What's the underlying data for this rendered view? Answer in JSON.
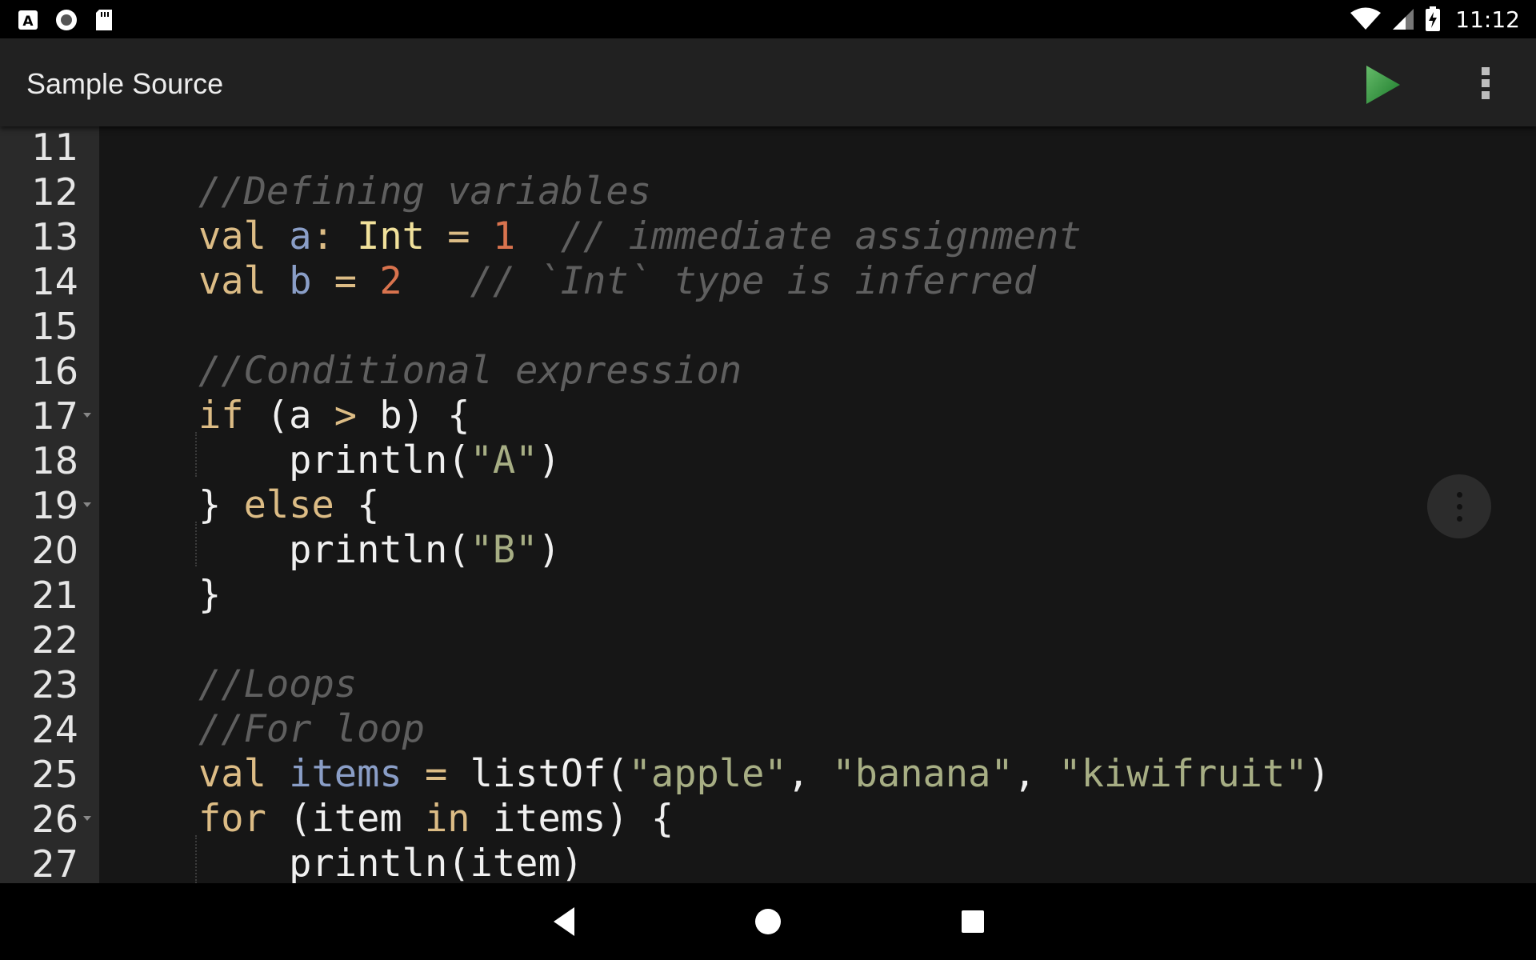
{
  "status_bar": {
    "time": "11:12",
    "left_icons": [
      "a-box-icon",
      "circle-icon",
      "sd-card-icon"
    ],
    "right_icons": [
      "wifi-icon",
      "signal-icon",
      "battery-charging-icon"
    ]
  },
  "app_bar": {
    "title": "Sample Source",
    "run_icon_color": "#43a047"
  },
  "editor": {
    "lines": [
      {
        "number": "11",
        "fold": false,
        "tokens": []
      },
      {
        "number": "12",
        "fold": false,
        "tokens": [
          {
            "t": "//Defining variables",
            "c": "comment"
          }
        ]
      },
      {
        "number": "13",
        "fold": false,
        "tokens": [
          {
            "t": "val",
            "c": "keyword"
          },
          {
            "t": " ",
            "c": "plain"
          },
          {
            "t": "a",
            "c": "var"
          },
          {
            "t": ": ",
            "c": "keyword"
          },
          {
            "t": "Int",
            "c": "type"
          },
          {
            "t": " = ",
            "c": "op"
          },
          {
            "t": "1",
            "c": "number"
          },
          {
            "t": "  ",
            "c": "plain"
          },
          {
            "t": "// immediate assignment",
            "c": "comment"
          }
        ]
      },
      {
        "number": "14",
        "fold": false,
        "tokens": [
          {
            "t": "val",
            "c": "keyword"
          },
          {
            "t": " ",
            "c": "plain"
          },
          {
            "t": "b",
            "c": "var"
          },
          {
            "t": " = ",
            "c": "op"
          },
          {
            "t": "2",
            "c": "number"
          },
          {
            "t": "   ",
            "c": "plain"
          },
          {
            "t": "// `Int` type is inferred",
            "c": "comment"
          }
        ]
      },
      {
        "number": "15",
        "fold": false,
        "tokens": []
      },
      {
        "number": "16",
        "fold": false,
        "tokens": [
          {
            "t": "//Conditional expression",
            "c": "comment"
          }
        ]
      },
      {
        "number": "17",
        "fold": true,
        "tokens": [
          {
            "t": "if",
            "c": "keyword"
          },
          {
            "t": " (a ",
            "c": "plain"
          },
          {
            "t": ">",
            "c": "op"
          },
          {
            "t": " b) {",
            "c": "plain"
          }
        ]
      },
      {
        "number": "18",
        "fold": false,
        "tokens": [
          {
            "t": "    println(",
            "c": "plain"
          },
          {
            "t": "\"A\"",
            "c": "string"
          },
          {
            "t": ")",
            "c": "plain"
          }
        ]
      },
      {
        "number": "19",
        "fold": true,
        "tokens": [
          {
            "t": "} ",
            "c": "plain"
          },
          {
            "t": "else",
            "c": "keyword"
          },
          {
            "t": " {",
            "c": "plain"
          }
        ]
      },
      {
        "number": "20",
        "fold": false,
        "tokens": [
          {
            "t": "    println(",
            "c": "plain"
          },
          {
            "t": "\"B\"",
            "c": "string"
          },
          {
            "t": ")",
            "c": "plain"
          }
        ]
      },
      {
        "number": "21",
        "fold": false,
        "tokens": [
          {
            "t": "}",
            "c": "plain"
          }
        ]
      },
      {
        "number": "22",
        "fold": false,
        "tokens": []
      },
      {
        "number": "23",
        "fold": false,
        "tokens": [
          {
            "t": "//Loops",
            "c": "comment"
          }
        ]
      },
      {
        "number": "24",
        "fold": false,
        "tokens": [
          {
            "t": "//For loop",
            "c": "comment"
          }
        ]
      },
      {
        "number": "25",
        "fold": false,
        "tokens": [
          {
            "t": "val",
            "c": "keyword"
          },
          {
            "t": " ",
            "c": "plain"
          },
          {
            "t": "items",
            "c": "var"
          },
          {
            "t": " = ",
            "c": "op"
          },
          {
            "t": "listOf(",
            "c": "plain"
          },
          {
            "t": "\"apple\"",
            "c": "string"
          },
          {
            "t": ", ",
            "c": "plain"
          },
          {
            "t": "\"banana\"",
            "c": "string"
          },
          {
            "t": ", ",
            "c": "plain"
          },
          {
            "t": "\"kiwifruit\"",
            "c": "string"
          },
          {
            "t": ")",
            "c": "plain"
          }
        ]
      },
      {
        "number": "26",
        "fold": true,
        "tokens": [
          {
            "t": "for",
            "c": "keyword"
          },
          {
            "t": " (item ",
            "c": "plain"
          },
          {
            "t": "in",
            "c": "keyword"
          },
          {
            "t": " items) {",
            "c": "plain"
          }
        ]
      },
      {
        "number": "27",
        "fold": false,
        "tokens": [
          {
            "t": "    println(item)",
            "c": "plain"
          }
        ]
      }
    ]
  },
  "nav_bar": {
    "buttons": [
      "back-icon",
      "home-icon",
      "recents-icon"
    ]
  }
}
